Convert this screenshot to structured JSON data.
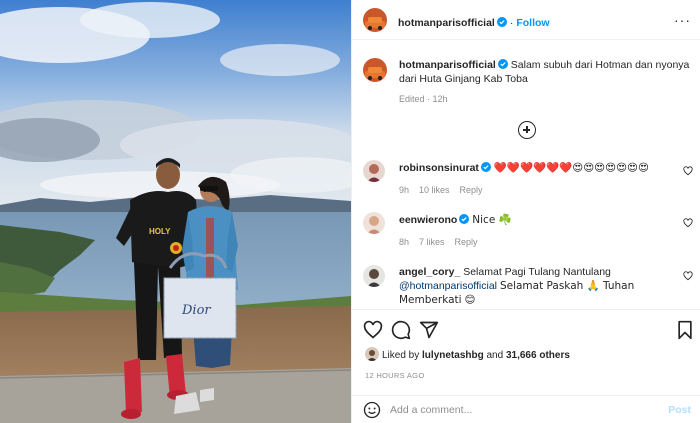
{
  "post": {
    "author": "hotmanparisofficial",
    "follow_label": "Follow",
    "more_label": "···",
    "caption": "Salam subuh dari Hotman dan nyonya dari Huta Ginjang Kab Toba",
    "caption_meta": "Edited · 12h",
    "photo_shirt_text": "HOLY",
    "photo_bag_text": "Dior"
  },
  "comments": [
    {
      "user": "robinsonsinurat",
      "verified": true,
      "text": "❤️❤️❤️❤️❤️❤️😍😍😍😍😍😍😍",
      "time": "9h",
      "likes": "10 likes",
      "reply": "Reply"
    },
    {
      "user": "eenwierono",
      "verified": true,
      "text": "Nice ☘️",
      "time": "8h",
      "likes": "7 likes",
      "reply": "Reply"
    },
    {
      "user": "angel_cory_",
      "verified": false,
      "text": "Selamat Pagi Tulang Nantulang",
      "mention": "@hotmanparisofficial",
      "text2": "Selamat Paskah 🙏 Tuhan Memberkati",
      "text3": "😊"
    }
  ],
  "likes": {
    "prefix": "Liked by",
    "user": "lulynetashbg",
    "joiner": "and",
    "others": "31,666 others"
  },
  "time_ago": "12 HOURS AGO",
  "add_comment": {
    "placeholder": "Add a comment...",
    "post_label": "Post"
  },
  "icons": [
    "heart-icon",
    "comment-icon",
    "share-icon",
    "bookmark-icon",
    "emoji-icon",
    "verified-icon",
    "add-icon",
    "more-icon"
  ],
  "colors": {
    "accent": "#0095f6",
    "post_disabled": "#b2dffc",
    "muted": "#8e8e8e",
    "verified": "#0095f6"
  }
}
